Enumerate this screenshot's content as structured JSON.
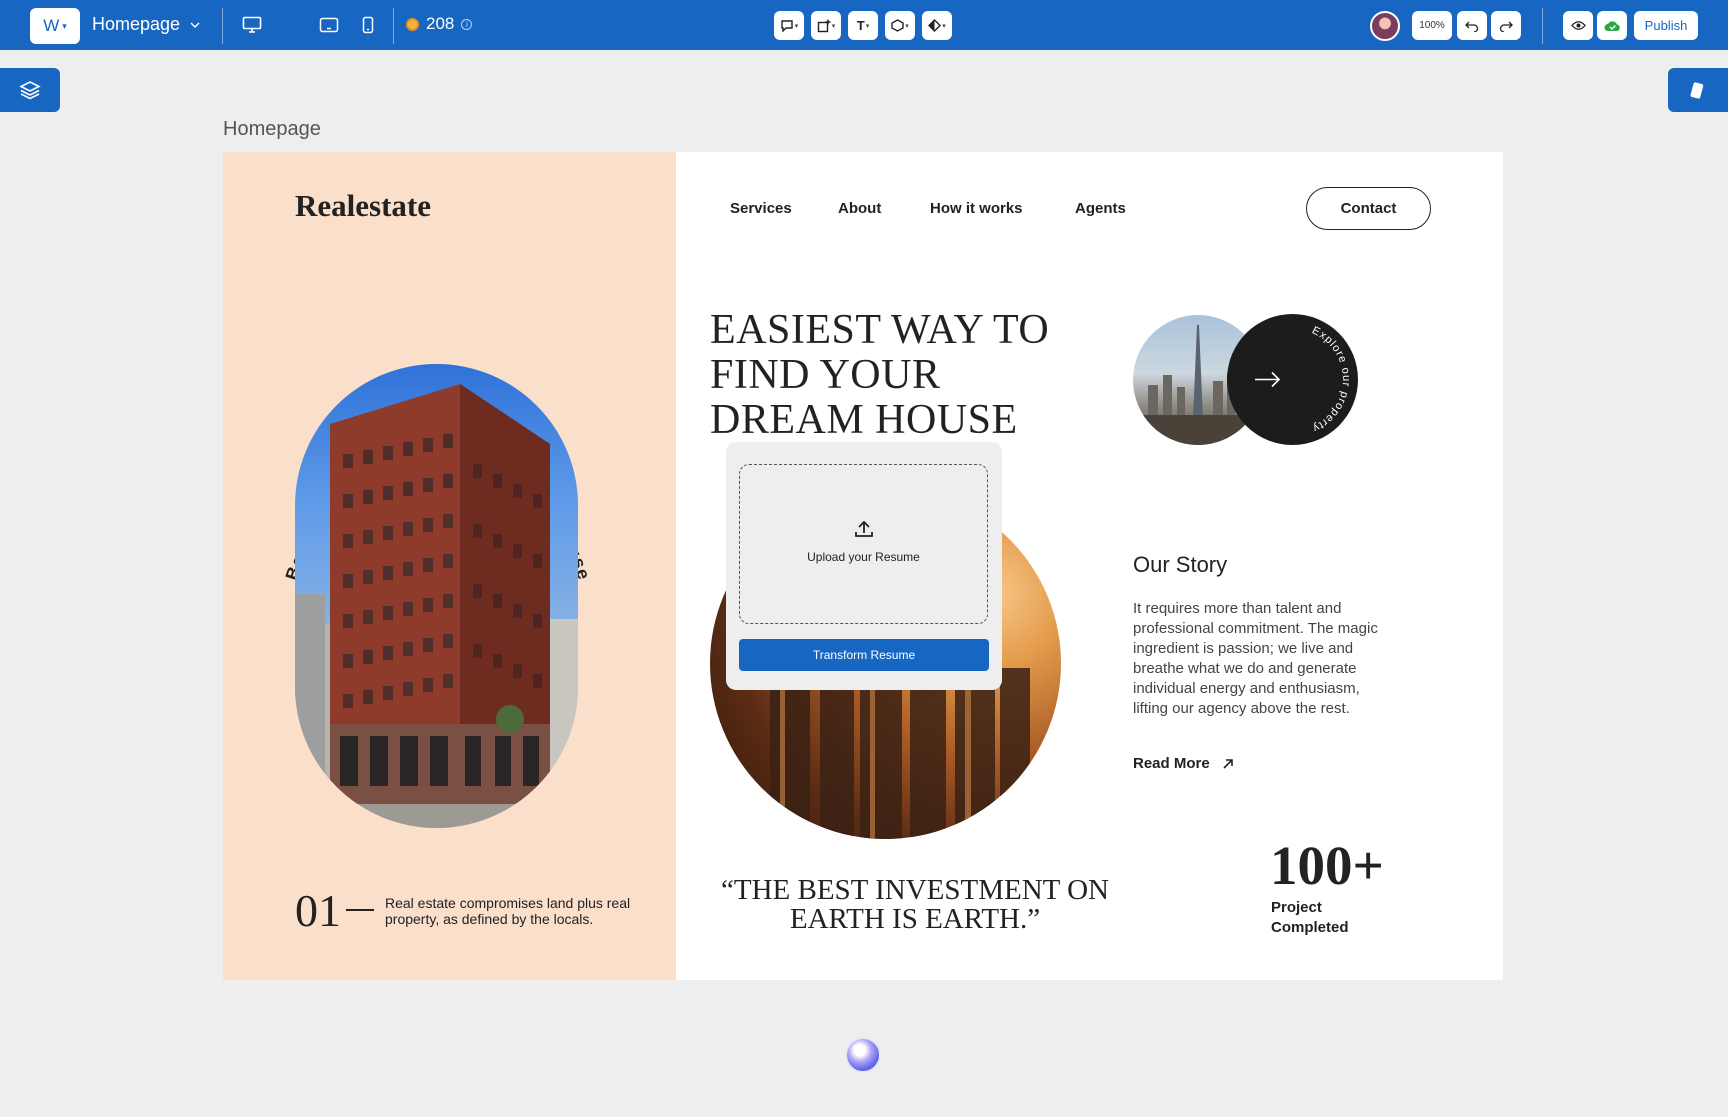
{
  "toolbar": {
    "logo_text": "W",
    "page_name": "Homepage",
    "credits": "208",
    "zoom": "100%",
    "publish_label": "Publish"
  },
  "canvas": {
    "page_label": "Homepage"
  },
  "site": {
    "brand": "Realestate",
    "nav": [
      "Services",
      "About",
      "How it works",
      "Agents"
    ],
    "contact_label": "Contact",
    "arc_text": "Best constructors for your dream house",
    "hero_title": "EASIEST WAY TO FIND YOUR DREAM HOUSE",
    "explore_text": "Explore our property",
    "story_title": "Our Story",
    "story_text": "It requires more than talent and professional commitment. The magic ingredient is passion; we live and breathe what we do and generate individual energy and enthusiasm, lifting our agency above the rest.",
    "read_more": "Read More",
    "left_number": "01",
    "left_desc": "Real estate compromises land plus real property, as defined by the locals.",
    "quote": "“THE BEST INVESTMENT ON EARTH IS EARTH.”",
    "stat_number": "100+",
    "stat_label": "Project Completed"
  },
  "upload": {
    "label": "Upload your Resume",
    "button_label": "Transform Resume"
  },
  "colors": {
    "accent": "#1766c2",
    "peach": "#fadfcb",
    "dark": "#1c1c1c"
  }
}
